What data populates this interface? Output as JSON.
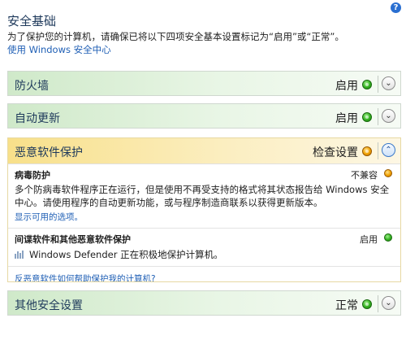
{
  "header": {
    "title": "安全基础",
    "description": "为了保护您的计算机，请确保已将以下四项安全基本设置标记为“启用”或“正常”。",
    "wsc_link": "使用 Windows 安全中心",
    "help_icon": "help-icon",
    "help_glyph": "?"
  },
  "firewall": {
    "title": "防火墙",
    "status": "启用",
    "status_color": "#33b020",
    "expander_glyph": "⌄"
  },
  "auto_update": {
    "title": "自动更新",
    "status": "启用",
    "status_color": "#33b020",
    "expander_glyph": "⌄"
  },
  "malware": {
    "title": "恶意软件保护",
    "status": "检查设置",
    "status_color": "#f0a000",
    "expander_glyph": "⌃",
    "virus": {
      "title": "病毒防护",
      "status": "不兼容",
      "status_color": "#f0a000",
      "text": "多个防病毒软件程序正在运行，但是使用不再受支持的格式将其状态报告给 Windows 安全中心。请使用程序的自动更新功能，或与程序制造商联系以获得更新版本。",
      "link": "显示可用的选项。"
    },
    "spyware": {
      "title": "间谍软件和其他恶意软件保护",
      "status": "启用",
      "status_color": "#33b020",
      "text": "Windows Defender 正在积极地保护计算机。"
    },
    "footer_link": "反恶意软件如何帮助保护我的计算机?"
  },
  "other": {
    "title": "其他安全设置",
    "status": "正常",
    "status_color": "#33b020",
    "expander_glyph": "⌄"
  }
}
